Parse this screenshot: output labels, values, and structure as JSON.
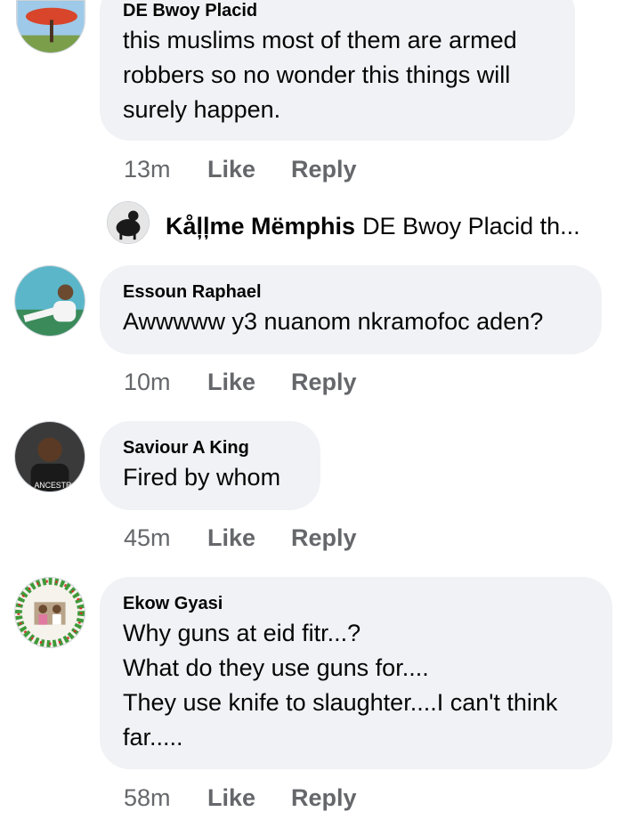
{
  "comments": [
    {
      "author": "DE Bwoy Placid",
      "text": "this muslims most of them are armed\nrobbers so no wonder this things will\nsurely happen.",
      "time": "13m",
      "like": "Like",
      "reply": "Reply",
      "avatar_icon": "tree-avatar-icon"
    },
    {
      "author": "Essoun Raphael",
      "text": "Awwwww y3 nuanom nkramofoc aden?",
      "time": "10m",
      "like": "Like",
      "reply": "Reply",
      "avatar_icon": "person-avatar-icon"
    },
    {
      "author": "Saviour A King",
      "text": "Fired by whom",
      "time": "45m",
      "like": "Like",
      "reply": "Reply",
      "avatar_icon": "person-avatar-icon"
    },
    {
      "author": "Ekow Gyasi",
      "text": "Why guns at eid fitr...?\nWhat do they use guns for....\nThey use knife to slaughter....I can't think\nfar.....",
      "time": "58m",
      "like": "Like",
      "reply": "Reply",
      "avatar_icon": "family-avatar-icon"
    }
  ],
  "reply_preview": {
    "author": "Kåļļme Mëmphis",
    "text": "DE Bwoy Placid th..."
  },
  "colors": {
    "bubble": "#f0f2f5",
    "meta_text": "#65676b",
    "body_text": "#050505"
  }
}
